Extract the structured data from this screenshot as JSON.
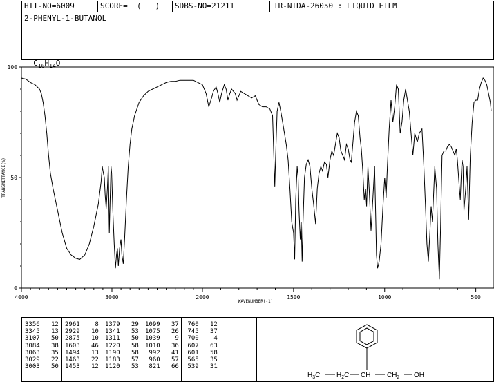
{
  "header": {
    "hit_no": "HIT-NO=6009",
    "score": "SCORE=  (   )",
    "sdbs_no": "SDBS-NO=21211",
    "ir_info": "IR-NIDA-26050 : LIQUID FILM",
    "compound_name": "2-PHENYL-1-BUTANOL",
    "formula_c": "C",
    "formula_c_sub": "10",
    "formula_h": "H",
    "formula_h_sub": "14",
    "formula_o": "O"
  },
  "chart_data": {
    "type": "line",
    "xlabel": "WAVENUMBER(-1)",
    "ylabel": "TRANSMITTANCE(%)",
    "xlim": [
      4000,
      400
    ],
    "ylim": [
      0,
      100
    ],
    "x_ticks": [
      "4000",
      "3000",
      "2000",
      "1500",
      "1000",
      "500"
    ],
    "y_ticks": [
      "100",
      "50",
      "0"
    ],
    "series": [
      {
        "points": [
          [
            4000,
            95
          ],
          [
            3950,
            94.5
          ],
          [
            3900,
            93
          ],
          [
            3850,
            92
          ],
          [
            3800,
            90
          ],
          [
            3780,
            88
          ],
          [
            3760,
            84
          ],
          [
            3740,
            78
          ],
          [
            3720,
            70
          ],
          [
            3700,
            60
          ],
          [
            3680,
            52
          ],
          [
            3650,
            45
          ],
          [
            3600,
            35
          ],
          [
            3550,
            25
          ],
          [
            3500,
            18
          ],
          [
            3450,
            15
          ],
          [
            3400,
            13.5
          ],
          [
            3356,
            13
          ],
          [
            3300,
            15
          ],
          [
            3250,
            20
          ],
          [
            3200,
            28
          ],
          [
            3150,
            38
          ],
          [
            3120,
            48
          ],
          [
            3107,
            55
          ],
          [
            3095,
            52
          ],
          [
            3084,
            50
          ],
          [
            3075,
            42
          ],
          [
            3063,
            36
          ],
          [
            3050,
            45
          ],
          [
            3040,
            55
          ],
          [
            3029,
            25
          ],
          [
            3020,
            40
          ],
          [
            3010,
            55
          ],
          [
            3003,
            52
          ],
          [
            2990,
            35
          ],
          [
            2975,
            20
          ],
          [
            2961,
            9
          ],
          [
            2950,
            15
          ],
          [
            2940,
            18
          ],
          [
            2929,
            10
          ],
          [
            2915,
            18
          ],
          [
            2900,
            22
          ],
          [
            2890,
            15
          ],
          [
            2875,
            11
          ],
          [
            2860,
            22
          ],
          [
            2840,
            40
          ],
          [
            2820,
            55
          ],
          [
            2800,
            65
          ],
          [
            2780,
            72
          ],
          [
            2750,
            78
          ],
          [
            2700,
            84
          ],
          [
            2650,
            87
          ],
          [
            2600,
            89
          ],
          [
            2550,
            90
          ],
          [
            2500,
            91
          ],
          [
            2450,
            92
          ],
          [
            2400,
            93
          ],
          [
            2350,
            93.5
          ],
          [
            2300,
            93.5
          ],
          [
            2250,
            94
          ],
          [
            2200,
            94
          ],
          [
            2150,
            94
          ],
          [
            2100,
            94
          ],
          [
            2050,
            93
          ],
          [
            2000,
            92
          ],
          [
            1980,
            88
          ],
          [
            1965,
            82
          ],
          [
            1950,
            86
          ],
          [
            1940,
            89
          ],
          [
            1925,
            91
          ],
          [
            1915,
            88
          ],
          [
            1905,
            84
          ],
          [
            1895,
            88
          ],
          [
            1880,
            92
          ],
          [
            1870,
            90
          ],
          [
            1860,
            85
          ],
          [
            1850,
            88
          ],
          [
            1840,
            90
          ],
          [
            1820,
            88
          ],
          [
            1810,
            85
          ],
          [
            1800,
            87
          ],
          [
            1790,
            89
          ],
          [
            1770,
            88
          ],
          [
            1750,
            87
          ],
          [
            1730,
            86
          ],
          [
            1710,
            87
          ],
          [
            1700,
            85
          ],
          [
            1690,
            83
          ],
          [
            1670,
            82
          ],
          [
            1650,
            82
          ],
          [
            1630,
            81
          ],
          [
            1615,
            78
          ],
          [
            1603,
            46
          ],
          [
            1598,
            60
          ],
          [
            1590,
            80
          ],
          [
            1580,
            84
          ],
          [
            1570,
            80
          ],
          [
            1560,
            75
          ],
          [
            1550,
            70
          ],
          [
            1540,
            65
          ],
          [
            1530,
            58
          ],
          [
            1520,
            45
          ],
          [
            1510,
            30
          ],
          [
            1500,
            25
          ],
          [
            1494,
            13
          ],
          [
            1488,
            40
          ],
          [
            1480,
            55
          ],
          [
            1475,
            50
          ],
          [
            1470,
            35
          ],
          [
            1463,
            22
          ],
          [
            1458,
            30
          ],
          [
            1453,
            12
          ],
          [
            1448,
            30
          ],
          [
            1440,
            50
          ],
          [
            1430,
            56
          ],
          [
            1420,
            58
          ],
          [
            1410,
            55
          ],
          [
            1400,
            45
          ],
          [
            1390,
            38
          ],
          [
            1379,
            29
          ],
          [
            1370,
            45
          ],
          [
            1360,
            52
          ],
          [
            1350,
            55
          ],
          [
            1341,
            53
          ],
          [
            1330,
            57
          ],
          [
            1320,
            56
          ],
          [
            1311,
            50
          ],
          [
            1300,
            58
          ],
          [
            1290,
            62
          ],
          [
            1280,
            60
          ],
          [
            1270,
            65
          ],
          [
            1260,
            70
          ],
          [
            1250,
            68
          ],
          [
            1240,
            62
          ],
          [
            1230,
            60
          ],
          [
            1220,
            58
          ],
          [
            1210,
            65
          ],
          [
            1200,
            63
          ],
          [
            1190,
            58
          ],
          [
            1183,
            57
          ],
          [
            1175,
            65
          ],
          [
            1165,
            75
          ],
          [
            1155,
            80
          ],
          [
            1145,
            78
          ],
          [
            1135,
            68
          ],
          [
            1128,
            63
          ],
          [
            1120,
            53
          ],
          [
            1112,
            40
          ],
          [
            1105,
            45
          ],
          [
            1099,
            37
          ],
          [
            1092,
            55
          ],
          [
            1085,
            45
          ],
          [
            1075,
            26
          ],
          [
            1065,
            40
          ],
          [
            1055,
            55
          ],
          [
            1050,
            35
          ],
          [
            1045,
            15
          ],
          [
            1039,
            9
          ],
          [
            1030,
            12
          ],
          [
            1020,
            20
          ],
          [
            1010,
            36
          ],
          [
            1000,
            50
          ],
          [
            992,
            41
          ],
          [
            985,
            55
          ],
          [
            975,
            72
          ],
          [
            965,
            85
          ],
          [
            960,
            80
          ],
          [
            955,
            75
          ],
          [
            945,
            82
          ],
          [
            935,
            92
          ],
          [
            925,
            90
          ],
          [
            915,
            70
          ],
          [
            905,
            75
          ],
          [
            895,
            85
          ],
          [
            885,
            90
          ],
          [
            875,
            85
          ],
          [
            865,
            80
          ],
          [
            855,
            70
          ],
          [
            845,
            60
          ],
          [
            835,
            70
          ],
          [
            821,
            66
          ],
          [
            810,
            70
          ],
          [
            795,
            72
          ],
          [
            785,
            55
          ],
          [
            775,
            35
          ],
          [
            768,
            20
          ],
          [
            760,
            12
          ],
          [
            752,
            25
          ],
          [
            745,
            37
          ],
          [
            738,
            30
          ],
          [
            725,
            55
          ],
          [
            715,
            45
          ],
          [
            708,
            20
          ],
          [
            700,
            4
          ],
          [
            694,
            25
          ],
          [
            685,
            60
          ],
          [
            675,
            62
          ],
          [
            665,
            62
          ],
          [
            655,
            64
          ],
          [
            645,
            65
          ],
          [
            635,
            64
          ],
          [
            625,
            62
          ],
          [
            615,
            60
          ],
          [
            607,
            63
          ],
          [
            601,
            58
          ],
          [
            590,
            45
          ],
          [
            585,
            40
          ],
          [
            580,
            50
          ],
          [
            575,
            58
          ],
          [
            570,
            55
          ],
          [
            565,
            35
          ],
          [
            555,
            45
          ],
          [
            548,
            55
          ],
          [
            539,
            31
          ],
          [
            530,
            60
          ],
          [
            520,
            75
          ],
          [
            510,
            84
          ],
          [
            500,
            85
          ],
          [
            490,
            85
          ],
          [
            480,
            90
          ],
          [
            470,
            93
          ],
          [
            460,
            95
          ],
          [
            450,
            94
          ],
          [
            440,
            92
          ],
          [
            430,
            88
          ],
          [
            420,
            84
          ],
          [
            415,
            80
          ]
        ]
      }
    ],
    "peak_table": [
      [
        [
          "3356",
          "12"
        ],
        [
          "3345",
          "13"
        ],
        [
          "3107",
          "50"
        ],
        [
          "3084",
          "38"
        ],
        [
          "3063",
          "35"
        ],
        [
          "3029",
          "22"
        ],
        [
          "3003",
          "50"
        ]
      ],
      [
        [
          "2961",
          "8"
        ],
        [
          "2929",
          "10"
        ],
        [
          "2875",
          "10"
        ],
        [
          "1603",
          "46"
        ],
        [
          "1494",
          "13"
        ],
        [
          "1463",
          "22"
        ],
        [
          "1453",
          "12"
        ]
      ],
      [
        [
          "1379",
          "29"
        ],
        [
          "1341",
          "53"
        ],
        [
          "1311",
          "50"
        ],
        [
          "1220",
          "58"
        ],
        [
          "1190",
          "58"
        ],
        [
          "1183",
          "57"
        ],
        [
          "1120",
          "53"
        ]
      ],
      [
        [
          "1099",
          "37"
        ],
        [
          "1075",
          "26"
        ],
        [
          "1039",
          "9"
        ],
        [
          "1010",
          "36"
        ],
        [
          "992",
          "41"
        ],
        [
          "960",
          "57"
        ],
        [
          "821",
          "66"
        ]
      ],
      [
        [
          "760",
          "12"
        ],
        [
          "745",
          "37"
        ],
        [
          "700",
          "4"
        ],
        [
          "607",
          "63"
        ],
        [
          "601",
          "58"
        ],
        [
          "565",
          "35"
        ],
        [
          "539",
          "31"
        ]
      ]
    ]
  },
  "structure": {
    "ch3": "H",
    "ch3_sub": "3",
    "ch3_c": "C",
    "ch2": "H",
    "ch2_sub": "2",
    "ch2_c": "C",
    "ch": "CH",
    "ch2b": "CH",
    "ch2b_sub": "2",
    "oh": "OH"
  }
}
